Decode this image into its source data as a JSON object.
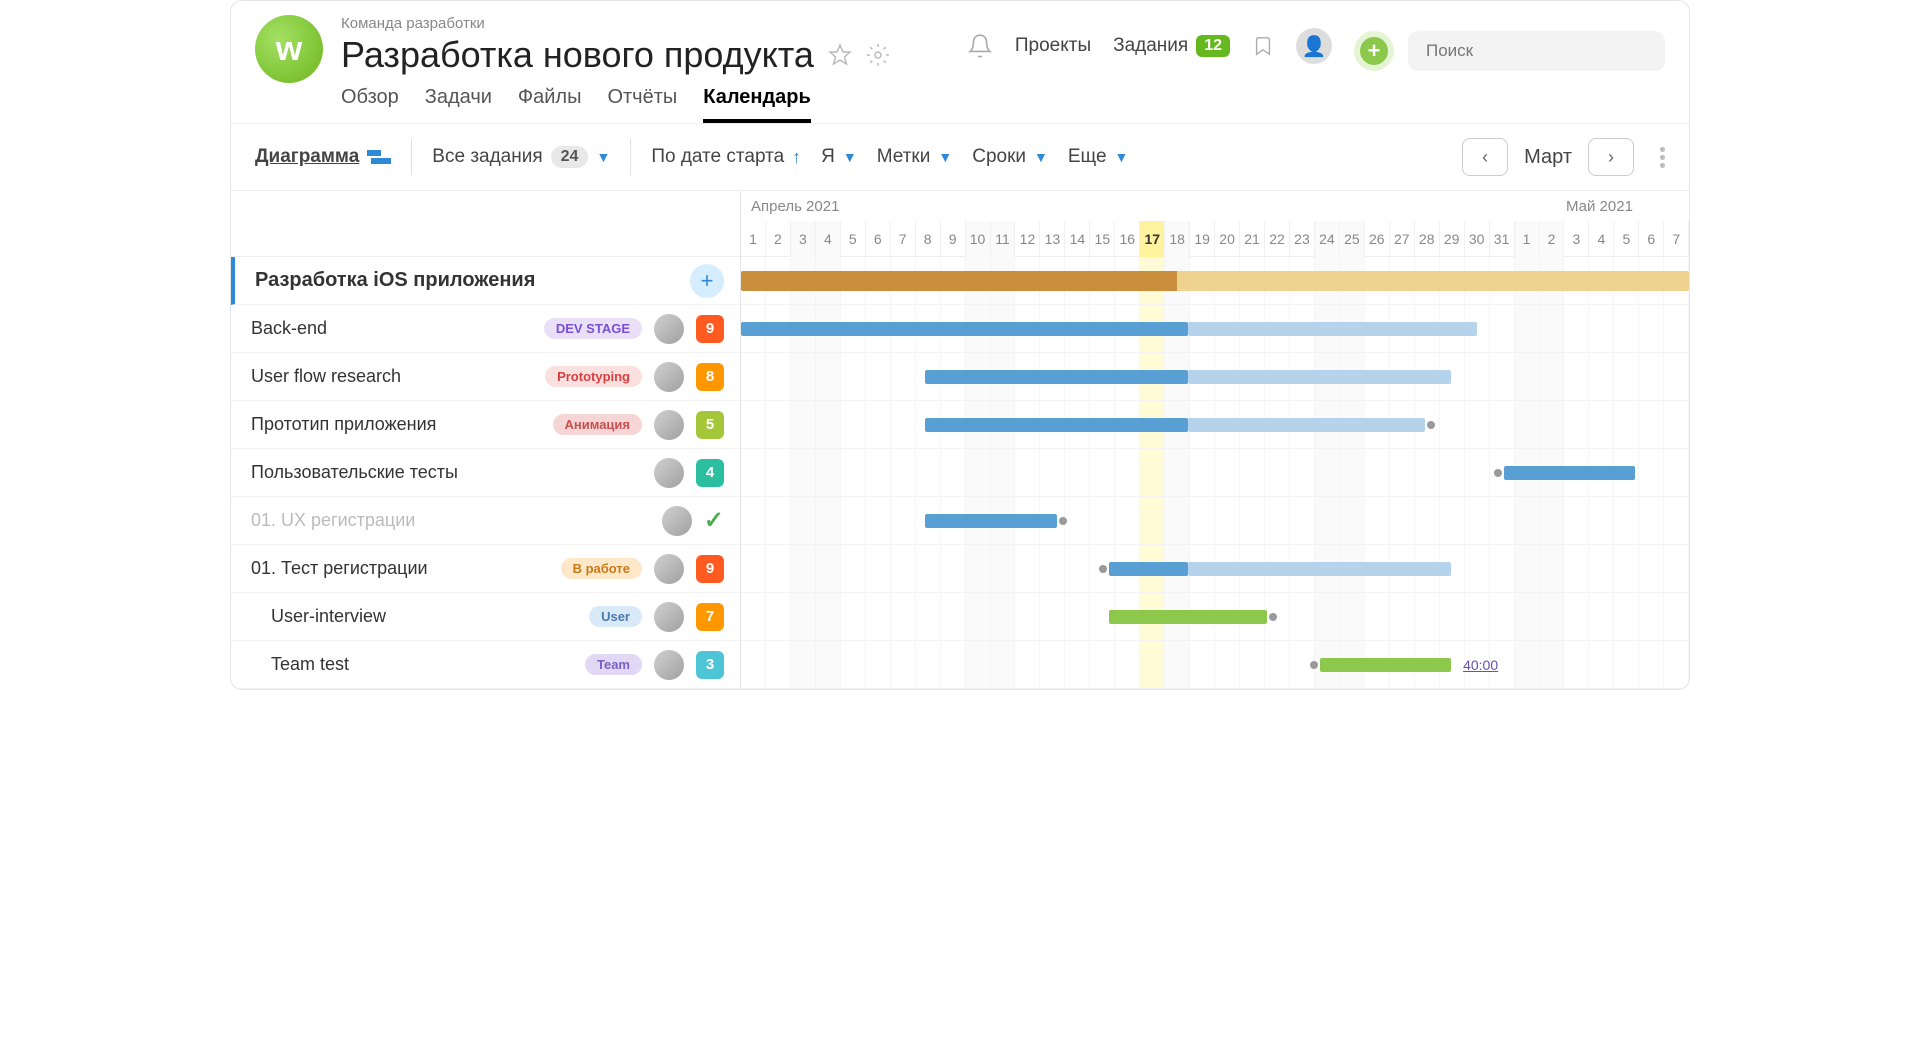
{
  "header": {
    "breadcrumb": "Команда разработки",
    "title": "Разработка нового продукта",
    "nav_projects": "Проекты",
    "nav_tasks": "Задания",
    "tasks_count": "12",
    "search_placeholder": "Поиск"
  },
  "tabs": [
    "Обзор",
    "Задачи",
    "Файлы",
    "Отчёты",
    "Календарь"
  ],
  "active_tab": 4,
  "toolbar": {
    "diagram": "Диаграмма",
    "all_tasks": "Все задания",
    "all_tasks_count": "24",
    "by_start": "По дате старта",
    "me": "Я",
    "labels": "Метки",
    "deadlines": "Сроки",
    "more": "Еще",
    "month": "Март"
  },
  "timeline": {
    "month1": "Апрель 2021",
    "month2": "Май 2021",
    "days": [
      {
        "d": "1",
        "w": false
      },
      {
        "d": "2",
        "w": false
      },
      {
        "d": "3",
        "w": true
      },
      {
        "d": "4",
        "w": true
      },
      {
        "d": "5",
        "w": false
      },
      {
        "d": "6",
        "w": false
      },
      {
        "d": "7",
        "w": false
      },
      {
        "d": "8",
        "w": false
      },
      {
        "d": "9",
        "w": false
      },
      {
        "d": "10",
        "w": true
      },
      {
        "d": "11",
        "w": true
      },
      {
        "d": "12",
        "w": false
      },
      {
        "d": "13",
        "w": false
      },
      {
        "d": "14",
        "w": false
      },
      {
        "d": "15",
        "w": false
      },
      {
        "d": "16",
        "w": false
      },
      {
        "d": "17",
        "w": false,
        "today": true
      },
      {
        "d": "18",
        "w": true
      },
      {
        "d": "19",
        "w": false
      },
      {
        "d": "20",
        "w": false
      },
      {
        "d": "21",
        "w": false
      },
      {
        "d": "22",
        "w": false
      },
      {
        "d": "23",
        "w": false
      },
      {
        "d": "24",
        "w": true
      },
      {
        "d": "25",
        "w": true
      },
      {
        "d": "26",
        "w": false
      },
      {
        "d": "27",
        "w": false
      },
      {
        "d": "28",
        "w": false
      },
      {
        "d": "29",
        "w": false
      },
      {
        "d": "30",
        "w": false
      },
      {
        "d": "31",
        "w": false
      },
      {
        "d": "1",
        "w": true
      },
      {
        "d": "2",
        "w": true
      },
      {
        "d": "3",
        "w": false
      },
      {
        "d": "4",
        "w": false
      },
      {
        "d": "5",
        "w": false
      },
      {
        "d": "6",
        "w": false
      },
      {
        "d": "7",
        "w": false
      }
    ]
  },
  "group": {
    "name": "Разработка iOS приложения"
  },
  "tasks": [
    {
      "name": "Back-end",
      "tag": "DEV STAGE",
      "tag_cls": "purple",
      "prio": "9",
      "prio_cls": "red",
      "bar_start": 0,
      "bar_solid_end": 17,
      "bar_light_end": 28,
      "indent": false
    },
    {
      "name": "User flow research",
      "tag": "Prototyping",
      "tag_cls": "red",
      "prio": "8",
      "prio_cls": "orange",
      "bar_start": 7,
      "bar_solid_end": 17,
      "bar_light_end": 27,
      "indent": false
    },
    {
      "name": "Прототип приложения",
      "tag": "Анимация",
      "tag_cls": "pink",
      "prio": "5",
      "prio_cls": "lime",
      "bar_start": 7,
      "bar_solid_end": 17,
      "bar_light_end": 26,
      "dep_end": true,
      "indent": false
    },
    {
      "name": "Пользовательские тесты",
      "tag": null,
      "prio": "4",
      "prio_cls": "teal",
      "bar_start": 29,
      "bar_solid_end": 34,
      "bar_light_end": 34,
      "dep_start": true,
      "indent": false
    },
    {
      "name": "01. UX регистрации",
      "tag": null,
      "prio": null,
      "done": true,
      "bar_start": 7,
      "bar_solid_end": 12,
      "bar_light_end": 12,
      "dep_end": true,
      "indent": false
    },
    {
      "name": "01. Тест регистрации",
      "tag": "В работе",
      "tag_cls": "orange",
      "prio": "9",
      "prio_cls": "red",
      "bar_start": 14,
      "bar_solid_end": 17,
      "bar_light_end": 27,
      "dep_start": true,
      "indent": false
    },
    {
      "name": "User-interview",
      "tag": "User",
      "tag_cls": "blue",
      "prio": "7",
      "prio_cls": "orange",
      "bar_start": 14,
      "bar_green_end": 20,
      "green": true,
      "dep_end": true,
      "indent": true
    },
    {
      "name": "Team test",
      "tag": "Team",
      "tag_cls": "violet",
      "prio": "3",
      "prio_cls": "cyan",
      "bar_start": 22,
      "bar_green_end": 27,
      "green": true,
      "dep_start": true,
      "duration": "40:00",
      "indent": true
    }
  ]
}
